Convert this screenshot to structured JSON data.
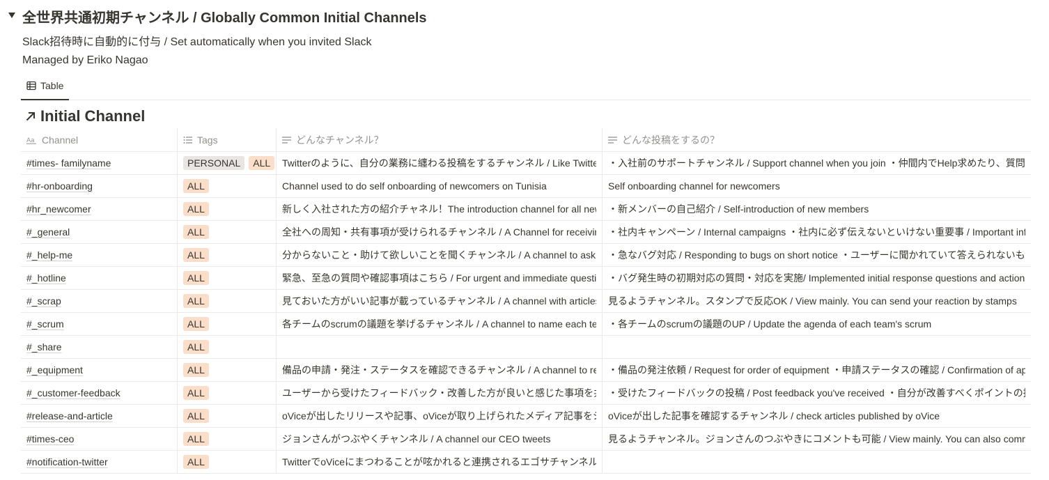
{
  "section": {
    "title": "全世界共通初期チャンネル / Globally Common Initial Channels",
    "description": "Slack招待時に自動的に付与 /  Set automatically when you invited Slack",
    "managed_by": "Managed by Eriko Nagao"
  },
  "view_tab": {
    "label": "Table",
    "icon": "table-icon"
  },
  "database": {
    "title": "Initial Channel",
    "icon": "arrow-up-right-icon"
  },
  "columns": [
    {
      "label": "Channel",
      "icon": "text-title-icon"
    },
    {
      "label": "Tags",
      "icon": "multi-select-icon"
    },
    {
      "label": "どんなチャンネル？",
      "icon": "text-lines-icon"
    },
    {
      "label": "どんな投稿をするの？",
      "icon": "text-lines-icon"
    }
  ],
  "rows": [
    {
      "channel": "#times- familyname",
      "tags": [
        "PERSONAL",
        "ALL"
      ],
      "what": "Twitterのように、自分の業務に纏わる投稿をするチャンネル / Like Twitter, th",
      "posts": "・入社前のサポートチャンネル / Support channel when you join  ・仲間内でHelp求めたり、質問した"
    },
    {
      "channel": "#hr-onboarding",
      "tags": [
        "ALL"
      ],
      "what": "Channel used to do self onboarding of newcomers on Tunisia",
      "posts": "Self onboarding channel for newcomers"
    },
    {
      "channel": "#hr_newcomer",
      "tags": [
        "ALL"
      ],
      "what": "新しく入社された方の紹介チャネル！The introduction channel for all new h",
      "posts": "・新メンバーの自己紹介 / Self-introduction of new members"
    },
    {
      "channel": "#_general",
      "tags": [
        "ALL"
      ],
      "what": "全社への周知・共有事項が受けられるチャンネル / A Channel for receiving co",
      "posts": "・社内キャンペーン / Internal campaigns  ・社内に必ず伝えないといけない重要事 / Important inform"
    },
    {
      "channel": "#_help-me",
      "tags": [
        "ALL"
      ],
      "what": "分からないこと・助けて欲しいことを聞くチャンネル / A channel to ask for h",
      "posts": "・急なバグ対応 / Responding to bugs on short notice  ・ユーザーに聞かれていて答えられないものを"
    },
    {
      "channel": "#_hotline",
      "tags": [
        "ALL"
      ],
      "what": "緊急、至急の質問や確認事項はこちら / For urgent and immediate questions",
      "posts": "・バグ発生時の初期対応の質問・対応を実施/ Implemented initial response questions and actions in"
    },
    {
      "channel": "#_scrap",
      "tags": [
        "ALL"
      ],
      "what": "見ておいた方がいい記事が載っているチャンネル / A channel with articles yo",
      "posts": "見るようチャンネル。スタンプで反応OK / View mainly. You can send your reaction by stamps"
    },
    {
      "channel": "#_scrum",
      "tags": [
        "ALL"
      ],
      "what": "各チームのscrumの議題を挙げるチャンネル / A channel to name each team",
      "posts": "・各チームのscrumの議題のUP / Update the agenda of each team's scrum"
    },
    {
      "channel": "#_share",
      "tags": [
        "ALL"
      ],
      "what": "",
      "posts": ""
    },
    {
      "channel": "#_equipment",
      "tags": [
        "ALL"
      ],
      "what": "備品の申請・発注・ステータスを確認できるチャンネル / A channel to reques",
      "posts": "・備品の発注依頼 / Request for order of equipment  ・申請ステータスの確認 / Confirmation of appl"
    },
    {
      "channel": "#_customer-feedback",
      "tags": [
        "ALL"
      ],
      "what": "ユーザーから受けたフィードバック・改善した方が良いと感じた事項を共有する",
      "posts": "・受けたフィードバックの投稿 / Post feedback you've received  ・自分が改善すべくポイントの投稿 /"
    },
    {
      "channel": "#release-and-article",
      "tags": [
        "ALL"
      ],
      "what": "oViceが出したリリースや記事、oViceが取り上げられたメディア記事をシェア",
      "posts": "oViceが出した記事を確認するチャンネル / check articles published by oVice"
    },
    {
      "channel": "#times-ceo",
      "tags": [
        "ALL"
      ],
      "what": "ジョンさんがつぶやくチャンネル / A channel our CEO tweets",
      "posts": "見るようチャンネル。ジョンさんのつぶやきにコメントも可能 / View mainly. You can also comment o"
    },
    {
      "channel": "#notification-twitter",
      "tags": [
        "ALL"
      ],
      "what": "TwitterでoViceにまつわることが呟かれると連携されるエゴサチャンネル / Ego",
      "posts": ""
    }
  ]
}
